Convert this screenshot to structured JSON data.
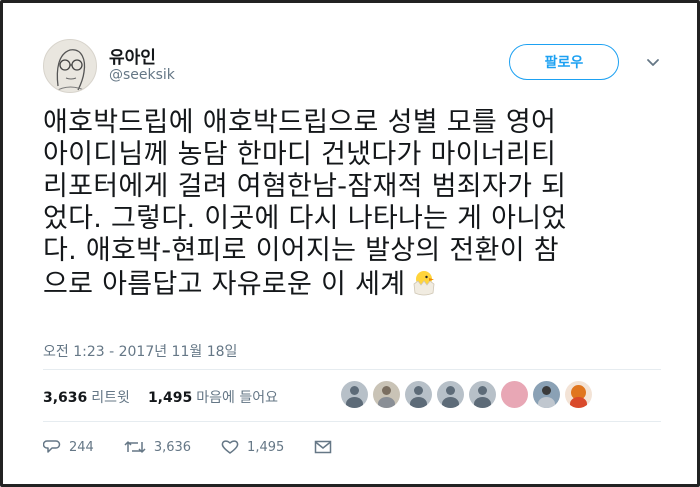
{
  "user": {
    "name": "유아인",
    "handle": "@seeksik"
  },
  "follow": {
    "label": "팔로우"
  },
  "icons": {
    "caret": "chevron-down-icon",
    "reply": "reply-icon",
    "retweet": "retweet-icon",
    "like": "heart-icon",
    "message": "envelope-icon",
    "emoji": "hatching-chick-emoji"
  },
  "tweet": {
    "lines": [
      "애호박드립에 애호박드립으로 성별 모를 영어",
      "아이디님께 농담 한마디 건냈다가 마이너리티",
      "리포터에게 걸려 여혐한남-잠재적 범죄자가 되",
      "었다. 그렇다. 이곳에 다시 나타나는 게 아니었",
      "다. 애호박-현피로 이어지는 발상의 전환이 참",
      "으로 아름답고 자유로운 이 세계"
    ],
    "timestamp": "오전 1:23 - 2017년 11월 18일"
  },
  "stats": {
    "retweets_count": "3,636",
    "retweets_label": "리트윗",
    "likes_count": "1,495",
    "likes_label": "마음에 들어요"
  },
  "actions": {
    "reply_count": "244",
    "retweet_count": "3,636",
    "like_count": "1,495"
  },
  "colors": {
    "accent": "#1da1f2",
    "secondary_text": "#657786",
    "divider": "#e6ecf0"
  }
}
